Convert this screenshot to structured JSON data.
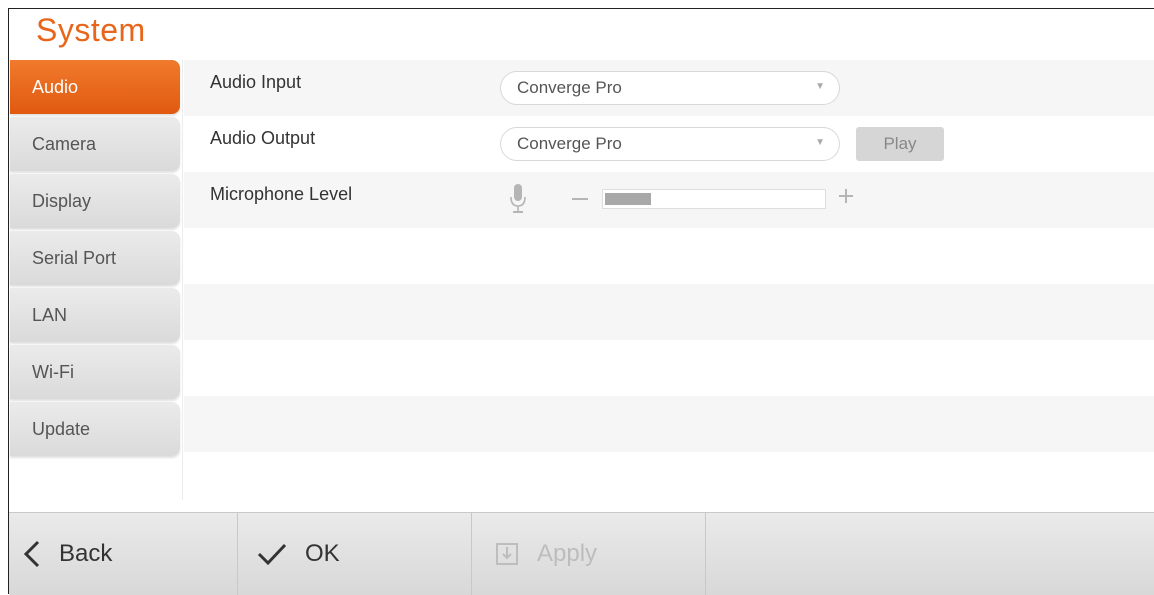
{
  "page": {
    "title": "System"
  },
  "sidebar": {
    "items": [
      {
        "label": "Audio",
        "active": true
      },
      {
        "label": "Camera"
      },
      {
        "label": "Display"
      },
      {
        "label": "Serial Port"
      },
      {
        "label": "LAN"
      },
      {
        "label": "Wi-Fi"
      },
      {
        "label": "Update"
      }
    ]
  },
  "settings": {
    "audio_input": {
      "label": "Audio Input",
      "value": "Converge Pro"
    },
    "audio_output": {
      "label": "Audio Output",
      "value": "Converge Pro",
      "play_label": "Play"
    },
    "microphone_level": {
      "label": "Microphone Level",
      "level_fraction": 0.21
    }
  },
  "footer": {
    "back_label": "Back",
    "ok_label": "OK",
    "apply_label": "Apply"
  },
  "colors": {
    "accent": "#e8661b",
    "active_tab": "#ea6a1e"
  }
}
